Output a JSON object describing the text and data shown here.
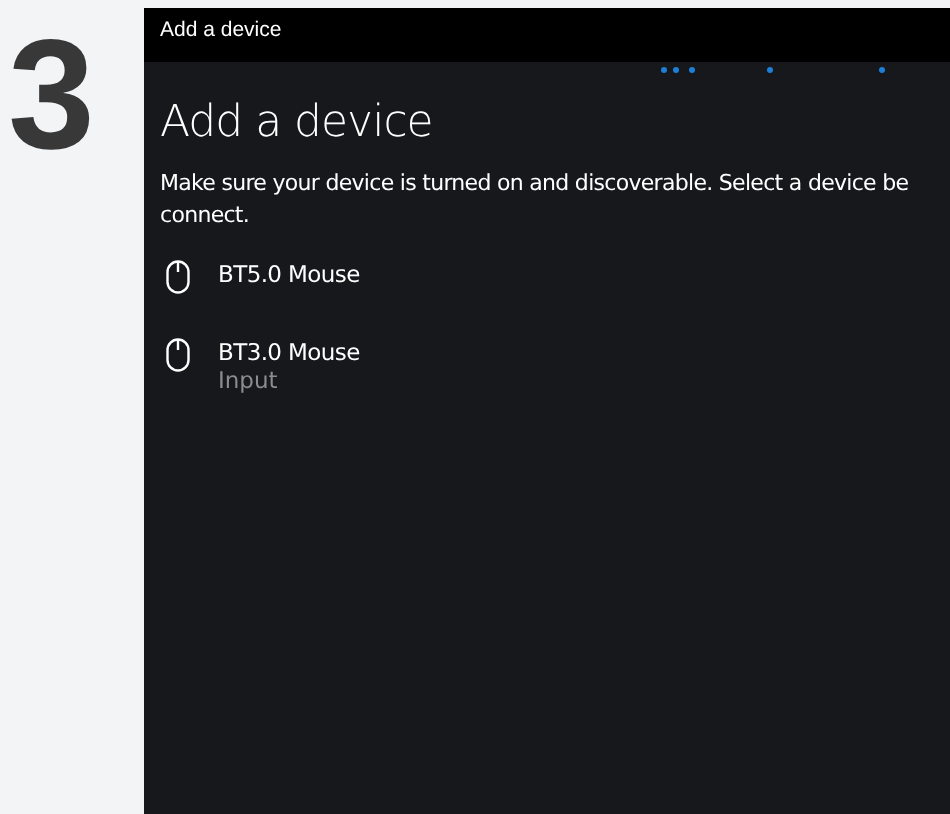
{
  "step_number": "3",
  "window": {
    "title": "Add a device"
  },
  "heading": "Add a device",
  "instructions": [
    "Make sure your device is turned on and discoverable. Select a device be",
    "connect."
  ],
  "devices": [
    {
      "name": "BT5.0 Mouse"
    },
    {
      "name": "BT3.0 Mouse",
      "subtitle": "Input"
    }
  ]
}
